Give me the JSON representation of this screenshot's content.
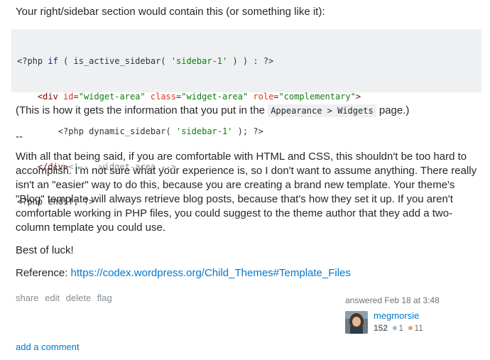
{
  "intro": "Your right/sidebar section would contain this (or something like it):",
  "code": {
    "l1_a": "<?php ",
    "l1_b": "if",
    "l1_c": " ( is_active_sidebar( ",
    "l1_d": "'sidebar-1'",
    "l1_e": " ) ) : ?>",
    "l2_a": "    <div ",
    "l2_b": "id",
    "l2_c": "=",
    "l2_d": "\"widget-area\"",
    "l2_e": " ",
    "l2_f": "class",
    "l2_g": "=",
    "l2_h": "\"widget-area\"",
    "l2_i": " ",
    "l2_j": "role",
    "l2_k": "=",
    "l2_l": "\"complementary\"",
    "l2_m": ">",
    "l3_a": "        <?php dynamic_sidebar( ",
    "l3_b": "'sidebar-1'",
    "l3_c": " ); ?>",
    "l4_a": "    </div>",
    "l4_b": "<!-- .widget-area -->",
    "l5": "<?php endif; ?>"
  },
  "appearance_note": {
    "before": "(This is how it gets the information that you put in the ",
    "code": "Appearance > Widgets",
    "after": " page.)"
  },
  "separator": "--",
  "main_text": "With all that being said, if you are comfortable with HTML and CSS, this shouldn't be too hard to accomplish. I'm not sure what your experience is, so I don't want to assume anything. There really isn't an \"easier\" way to do this, because you are creating a brand new template. Your theme's \"Blog\" template will always retrieve blog posts, because that's how they set it up. If you aren't comfortable working in PHP files, you could suggest to the theme author that they add a two-column template you could use.",
  "main_lines": [
    "With all that being said, if you are comfortable with HTML and CSS, this shouldn't be too hard to",
    "accomplish. I'm not sure what your experience is, so I don't want to assume anything. There really",
    "isn't an \"easier\" way to do this, because you are creating a brand new template. Your theme's",
    "\"Blog\" template will always retrieve blog posts, because that's how they set it up. If you aren't",
    "comfortable working in PHP files, you could suggest to the theme author that they add a two-",
    "column template you could use."
  ],
  "closing": "Best of luck!",
  "reference": {
    "label": "Reference: ",
    "url_text": "https://codex.wordpress.org/Child_Themes#Template_Files"
  },
  "post_menu": {
    "share": "share",
    "edit": "edit",
    "delete": "delete",
    "flag": "flag"
  },
  "user_card": {
    "action": "answered Feb 18 at 3:48",
    "name": "megmorsie",
    "reputation": "152",
    "silver_count": "1",
    "bronze_count": "11",
    "silver_color": "#b4b8bc",
    "bronze_color": "#d1a684"
  },
  "add_comment": "add a comment"
}
